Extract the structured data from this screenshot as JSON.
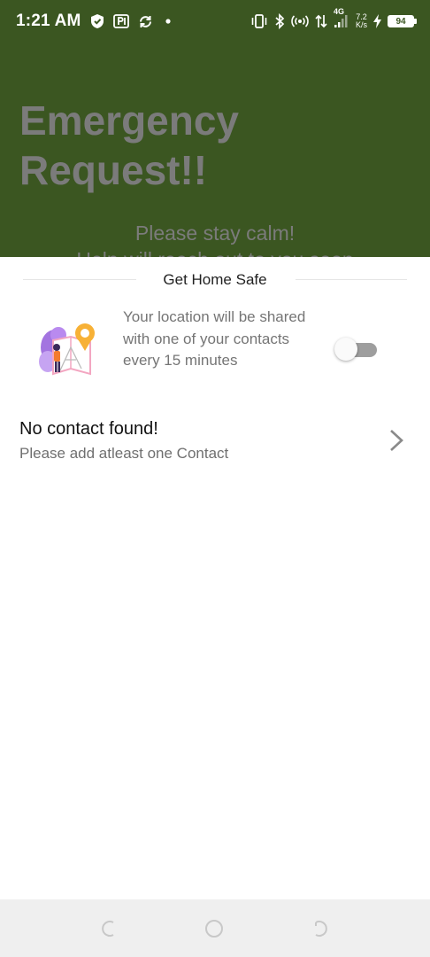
{
  "status_bar": {
    "time": "1:21 AM",
    "network_type": "4G",
    "speed_value": "7.2",
    "speed_unit": "K/s",
    "battery": "94",
    "icons": [
      "shield-icon",
      "parking-icon",
      "sync-icon",
      "dot-icon",
      "vibrate-icon",
      "bluetooth-icon",
      "hotspot-icon",
      "data-arrows-icon",
      "signal-icon",
      "charging-icon",
      "battery-icon"
    ]
  },
  "background": {
    "title_line1": "Emergency",
    "title_line2": "Request!!",
    "message_line1": "Please stay calm!",
    "message_line2": "Help will reach out to you soon",
    "color": "#3b5621"
  },
  "sheet": {
    "title": "Get Home Safe",
    "share": {
      "description": "Your location will be shared with one of your contacts every 15 minutes",
      "toggle_on": false
    },
    "contact": {
      "title": "No contact found!",
      "subtitle": "Please add atleast one Contact"
    }
  },
  "nav_bar": {
    "buttons": [
      "back-icon",
      "home-icon",
      "recents-icon"
    ]
  }
}
